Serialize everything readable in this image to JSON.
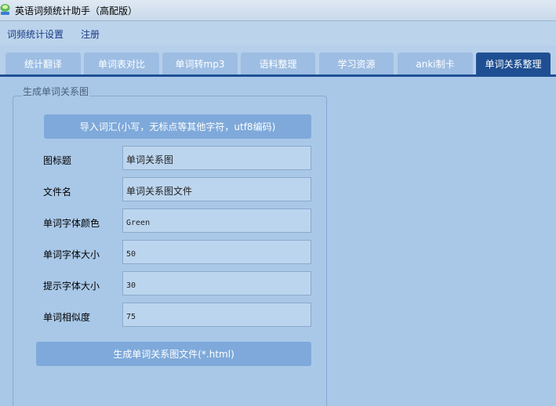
{
  "window": {
    "title": "英语词频统计助手（高配版）",
    "icon": "app-logo-icon"
  },
  "menu": {
    "items": [
      "词频统计设置",
      "注册"
    ]
  },
  "tabs": {
    "items": [
      "统计翻译",
      "单词表对比",
      "单词转mp3",
      "语料整理",
      "学习资源",
      "anki制卡",
      "单词关系整理"
    ],
    "active_index": 6
  },
  "panel": {
    "group_title": "生成单词关系图",
    "import_button": "导入词汇(小写，无标点等其他字符，utf8编码)",
    "fields": [
      {
        "label": "图标题",
        "value": "单词关系图"
      },
      {
        "label": "文件名",
        "value": "单词关系图文件"
      },
      {
        "label": "单词字体颜色",
        "value": "Green"
      },
      {
        "label": "单词字体大小",
        "value": "50"
      },
      {
        "label": "提示字体大小",
        "value": "30"
      },
      {
        "label": "单词相似度",
        "value": "75"
      }
    ],
    "generate_button": "生成单词关系图文件(*.html)"
  },
  "colors": {
    "background": "#a9c8e8",
    "tab_active": "#1f4f93",
    "tab_inactive": "#9dbde3",
    "button": "#7ea9da",
    "menu_text": "#1a3c86"
  }
}
